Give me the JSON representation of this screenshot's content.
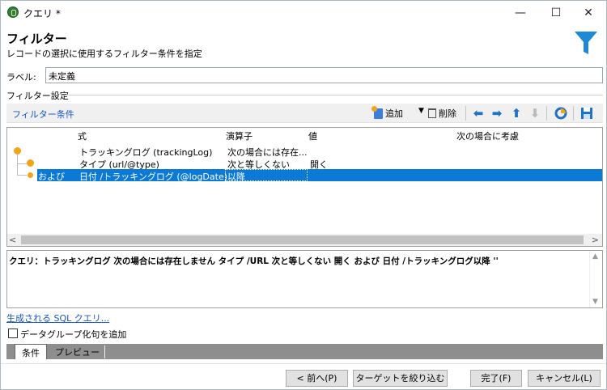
{
  "window": {
    "title": "クエリ *",
    "min_glyph": "—",
    "max_glyph": "☐",
    "close_glyph": "✕"
  },
  "header": {
    "title": "フィルター",
    "subtitle": "レコードの選択に使用するフィルター条件を指定"
  },
  "label_field": {
    "label": "ラベル:",
    "value": "未定義"
  },
  "filter_settings": {
    "group_label": "フィルター設定",
    "conditions_label": "フィルター条件",
    "toolbar": {
      "add_label": "追加",
      "delete_label": "削除",
      "icons": [
        "add-icon",
        "dropdown-icon",
        "trash-icon",
        "arrow-left-icon",
        "arrow-right-icon",
        "arrow-up-icon",
        "arrow-down-icon",
        "distribution-icon",
        "save-icon"
      ]
    },
    "columns": [
      "式",
      "演算子",
      "値",
      "次の場合に考慮"
    ],
    "rows": [
      {
        "prefix": "",
        "expression": "トラッキングログ (trackingLog)",
        "operator": "次の場合には存在...",
        "value": "",
        "selected": false
      },
      {
        "prefix": "",
        "expression": "タイプ (url/@type)",
        "operator": "次と等しくない",
        "value": "開く",
        "selected": false
      },
      {
        "prefix": "および",
        "expression": "日付 /トラッキングログ (@logDate)",
        "operator": "以降",
        "value": "",
        "selected": true
      }
    ]
  },
  "query_text": "クエリ：トラッキングログ 次の場合には存在しません タイプ /URL 次と等しくない 開く および 日付 /トラッキングログ以降 ''",
  "sql_link": "生成される SQL クエリ...",
  "checkbox": {
    "label": "データグループ化句を追加",
    "checked": false
  },
  "tabs": [
    "条件",
    "プレビュー"
  ],
  "buttons": {
    "back": "< 前へ(P)",
    "target": "ターゲットを絞り込む >",
    "finish": "完了(F)",
    "cancel": "キャンセル(L)"
  },
  "colors": {
    "accent_blue": "#0a7ad6",
    "link_blue": "#1a56c8",
    "condition_dot": "#f2a516",
    "filter_icon": "#1d8ad6"
  }
}
